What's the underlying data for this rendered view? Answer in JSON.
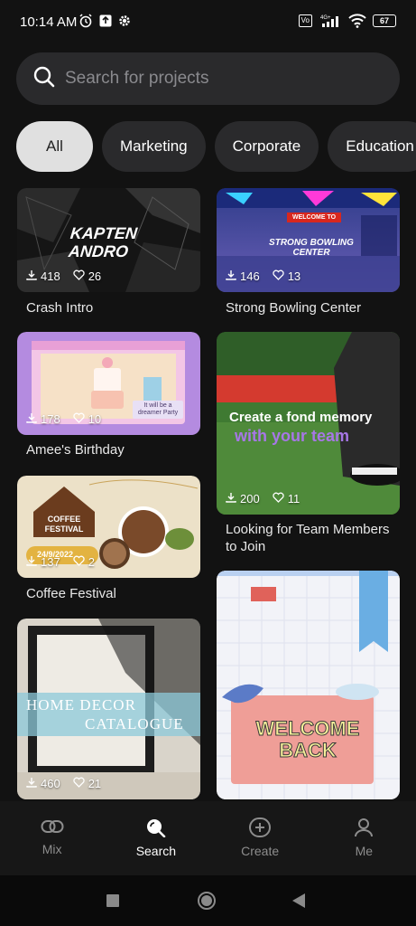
{
  "status_bar": {
    "time": "10:14 AM",
    "battery": "67",
    "network": "4G+"
  },
  "search": {
    "placeholder": "Search for projects"
  },
  "categories": [
    {
      "label": "All",
      "active": true
    },
    {
      "label": "Marketing",
      "active": false
    },
    {
      "label": "Corporate",
      "active": false
    },
    {
      "label": "Education",
      "active": false
    }
  ],
  "cards": [
    {
      "title": "Crash Intro",
      "downloads": "418",
      "likes": "26",
      "overlay_text": "KAPTEN ANDRO"
    },
    {
      "title": "Strong Bowling Center",
      "downloads": "146",
      "likes": "13",
      "overlay_text": "STRONG BOWLING CENTER",
      "badge_text": "WELCOME TO"
    },
    {
      "title": "Amee's Birthday",
      "downloads": "178",
      "likes": "10",
      "overlay_text": "It will be a dreamer Party"
    },
    {
      "title": "Looking for Team Members to Join",
      "title_line1": "Looking for Team Members",
      "title_line2": "to Join",
      "downloads": "200",
      "likes": "11",
      "overlay_line1": "Create a fond memory",
      "overlay_line2": "with your team"
    },
    {
      "title": "Coffee Festival",
      "downloads": "137",
      "likes": "2",
      "overlay_line1": "COFFEE",
      "overlay_line2": "FESTIVAL",
      "date_text": "24/9/2022"
    },
    {
      "downloads": "460",
      "likes": "21",
      "overlay_line1": "HOME DECOR",
      "overlay_line2": "CATALOGUE"
    },
    {
      "overlay_line1": "WELCOME",
      "overlay_line2": "BACK"
    }
  ],
  "nav": [
    {
      "label": "Mix",
      "icon": "link-icon",
      "active": false
    },
    {
      "label": "Search",
      "icon": "search-icon",
      "active": true
    },
    {
      "label": "Create",
      "icon": "plus-circle-icon",
      "active": false
    },
    {
      "label": "Me",
      "icon": "person-icon",
      "active": false
    }
  ],
  "colors": {
    "background": "#121212",
    "surface": "#2a2a2c",
    "active_chip": "#e0e0e0"
  }
}
